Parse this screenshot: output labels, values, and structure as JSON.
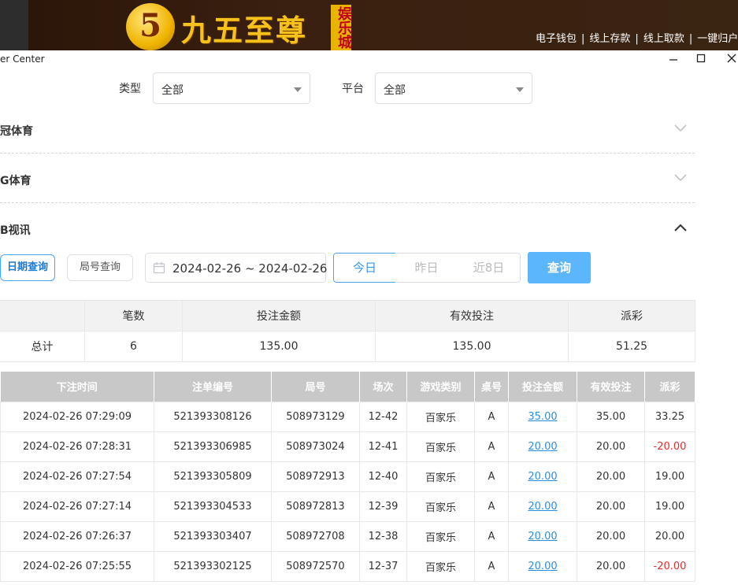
{
  "banner": {
    "logo_number": "5",
    "logo_text": "九五至尊",
    "logo_tag": "娱乐城",
    "links": [
      "电子钱包",
      "线上存款",
      "线上取款",
      "一键归户"
    ]
  },
  "window": {
    "title": "er Center",
    "minimize": "—",
    "maximize": "☐",
    "close": "✕"
  },
  "filters": {
    "type_label": "类型",
    "type_value": "全部",
    "platform_label": "平台",
    "platform_value": "全部"
  },
  "sections": [
    {
      "title": "冠体育",
      "expanded": false
    },
    {
      "title": "G体育",
      "expanded": false
    },
    {
      "title": "B视讯",
      "expanded": true
    }
  ],
  "query": {
    "date_query_label": "日期查询",
    "round_query_label": "局号查询",
    "date_range": "2024-02-26 ~ 2024-02-26",
    "quick_ranges": [
      "今日",
      "昨日",
      "近8日"
    ],
    "active_range": "今日",
    "submit_label": "查询"
  },
  "summary": {
    "headers": [
      "",
      "笔数",
      "投注金额",
      "有效投注",
      "派彩"
    ],
    "row": [
      "总计",
      "6",
      "135.00",
      "135.00",
      "51.25"
    ]
  },
  "records": {
    "headers": [
      "下注时间",
      "注单编号",
      "局号",
      "场次",
      "游戏类别",
      "桌号",
      "投注金额",
      "有效投注",
      "派彩"
    ],
    "rows": [
      [
        "2024-02-26 07:29:09",
        "521393308126",
        "508973129",
        "12-42",
        "百家乐",
        "A",
        "35.00",
        "35.00",
        "33.25"
      ],
      [
        "2024-02-26 07:28:31",
        "521393306985",
        "508973024",
        "12-41",
        "百家乐",
        "A",
        "20.00",
        "20.00",
        "-20.00"
      ],
      [
        "2024-02-26 07:27:54",
        "521393305809",
        "508972913",
        "12-40",
        "百家乐",
        "A",
        "20.00",
        "20.00",
        "19.00"
      ],
      [
        "2024-02-26 07:27:14",
        "521393304533",
        "508972813",
        "12-39",
        "百家乐",
        "A",
        "20.00",
        "20.00",
        "19.00"
      ],
      [
        "2024-02-26 07:26:37",
        "521393303407",
        "508972708",
        "12-38",
        "百家乐",
        "A",
        "20.00",
        "20.00",
        "20.00"
      ],
      [
        "2024-02-26 07:25:55",
        "521393302125",
        "508972570",
        "12-37",
        "百家乐",
        "A",
        "20.00",
        "20.00",
        "-20.00"
      ]
    ]
  },
  "colors": {
    "accent": "#4aa3f0",
    "query_button": "#5cb6fb",
    "negative": "#e03030"
  }
}
